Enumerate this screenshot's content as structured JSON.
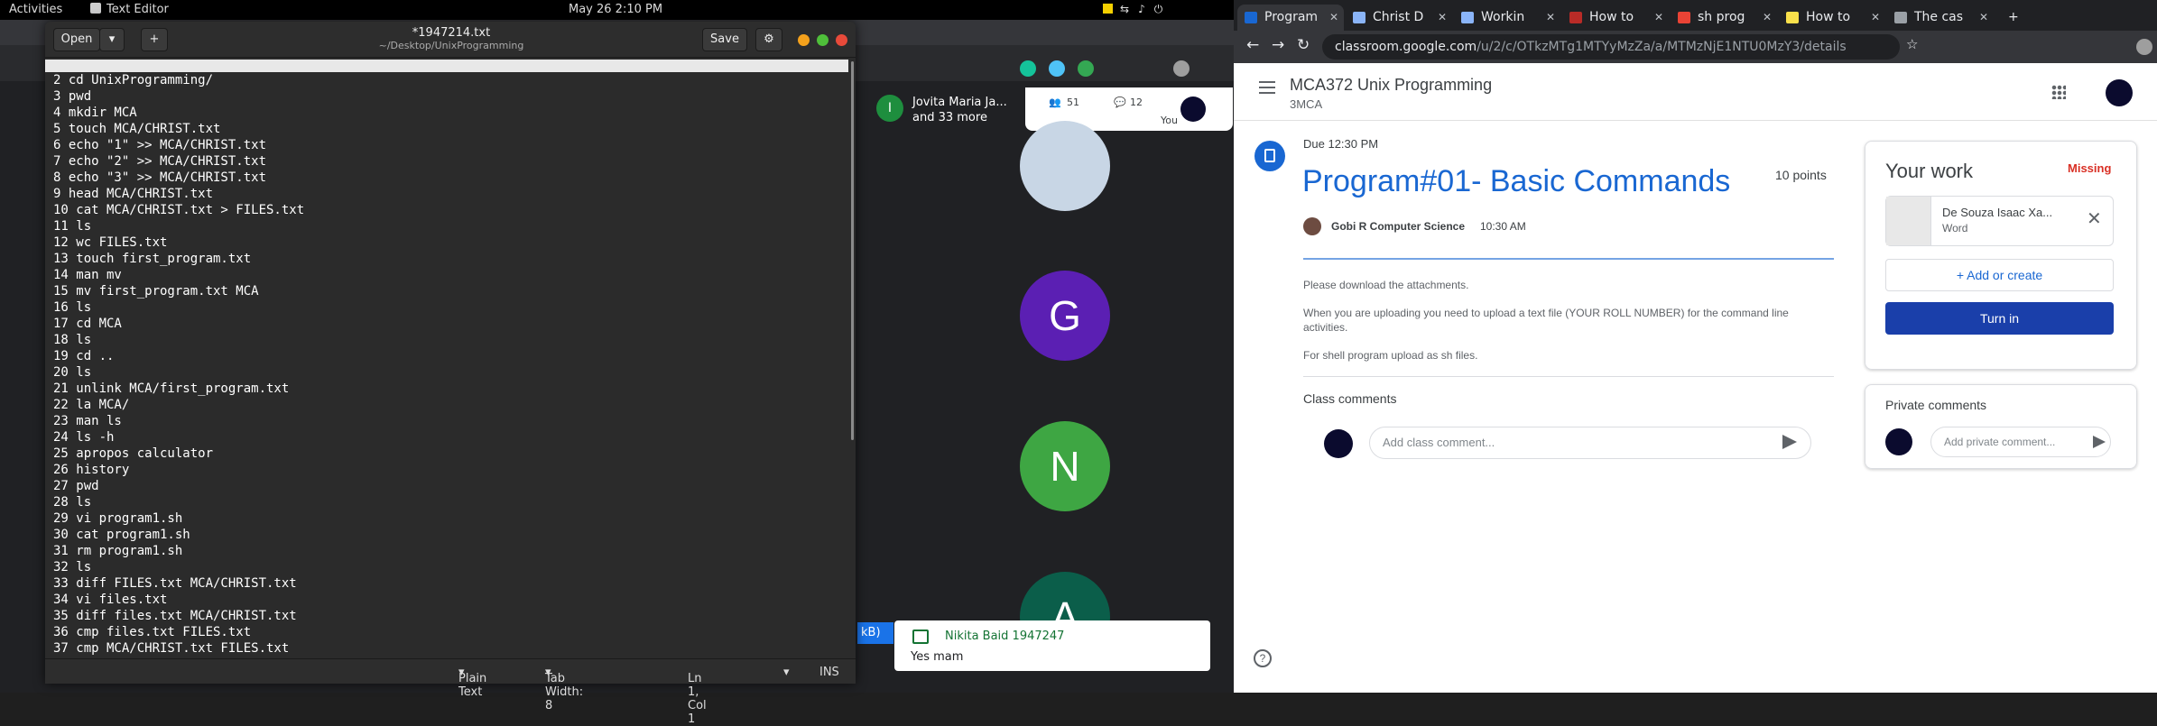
{
  "topbar": {
    "activities": "Activities",
    "app": "Text Editor",
    "clock": "May 26  2:10 PM"
  },
  "gedit": {
    "open": "Open",
    "save": "Save",
    "title": "*1947214.txt",
    "path": "~/Desktop/UnixProgramming",
    "lines": [
      "2 cd UnixProgramming/",
      "3 pwd",
      "4 mkdir MCA",
      "5 touch MCA/CHRIST.txt",
      "6 echo \"1\" >> MCA/CHRIST.txt",
      "7 echo \"2\" >> MCA/CHRIST.txt",
      "8 echo \"3\" >> MCA/CHRIST.txt",
      "9 head MCA/CHRIST.txt",
      "10 cat MCA/CHRIST.txt > FILES.txt",
      "11 ls",
      "12 wc FILES.txt",
      "13 touch first_program.txt",
      "14 man mv",
      "15 mv first_program.txt MCA",
      "16 ls",
      "17 cd MCA",
      "18 ls",
      "19 cd ..",
      "20 ls",
      "21 unlink MCA/first_program.txt",
      "22 la MCA/",
      "23 man ls",
      "24 ls -h",
      "25 apropos calculator",
      "26 history",
      "27 pwd",
      "28 ls",
      "29 vi program1.sh",
      "30 cat program1.sh",
      "31 rm program1.sh",
      "32 ls",
      "33 diff FILES.txt MCA/CHRIST.txt",
      "34 vi files.txt",
      "35 diff files.txt MCA/CHRIST.txt",
      "36 cmp files.txt FILES.txt",
      "37 cmp MCA/CHRIST.txt FILES.txt"
    ],
    "status": {
      "lang": "Plain Text",
      "tab": "Tab Width: 8",
      "pos": "Ln 1, Col 1",
      "mode": "INS"
    }
  },
  "meet": {
    "presenter": "Jovita Maria Ja...",
    "presenter_more": "and 33 more",
    "presenter_initial": "I",
    "participants_count": "51",
    "chat_count": "12",
    "you": "You",
    "tiles": [
      "G",
      "N",
      "A"
    ],
    "chat_name": "Nikita Baid 1947247",
    "chat_msg": "Yes mam",
    "kb": "kB)"
  },
  "browser": {
    "tabs": [
      "Program",
      "Christ D",
      "Workin",
      "How to",
      "sh prog",
      "How to",
      "The cas"
    ],
    "url_host": "classroom.google.com",
    "url_path": "/u/2/c/OTkzMTg1MTYyMzZa/a/MTMzNjE1NTU0MzY3/details"
  },
  "classroom": {
    "course": "MCA372 Unix Programming",
    "section": "3MCA",
    "due": "Due 12:30 PM",
    "title": "Program#01- Basic Commands",
    "points": "10 points",
    "teacher": "Gobi R Computer Science",
    "time": "10:30 AM",
    "desc1": "Please download the attachments.",
    "desc2": "When you are uploading you need to upload a text file (YOUR ROLL NUMBER) for the command line activities.",
    "desc3": "For shell program upload as sh files.",
    "comments_title": "Class comments",
    "comment_placeholder": "Add class comment...",
    "your_work": "Your work",
    "missing": "Missing",
    "attachment_name": "De Souza Isaac Xa...",
    "attachment_kind": "Word",
    "add_create": "Add or create",
    "turn_in": "Turn in",
    "private_title": "Private comments",
    "private_placeholder": "Add private comment..."
  },
  "colors": {
    "classroom_blue": "#1967d2",
    "missing_red": "#d93025",
    "turnin_blue": "#1a3faa"
  }
}
